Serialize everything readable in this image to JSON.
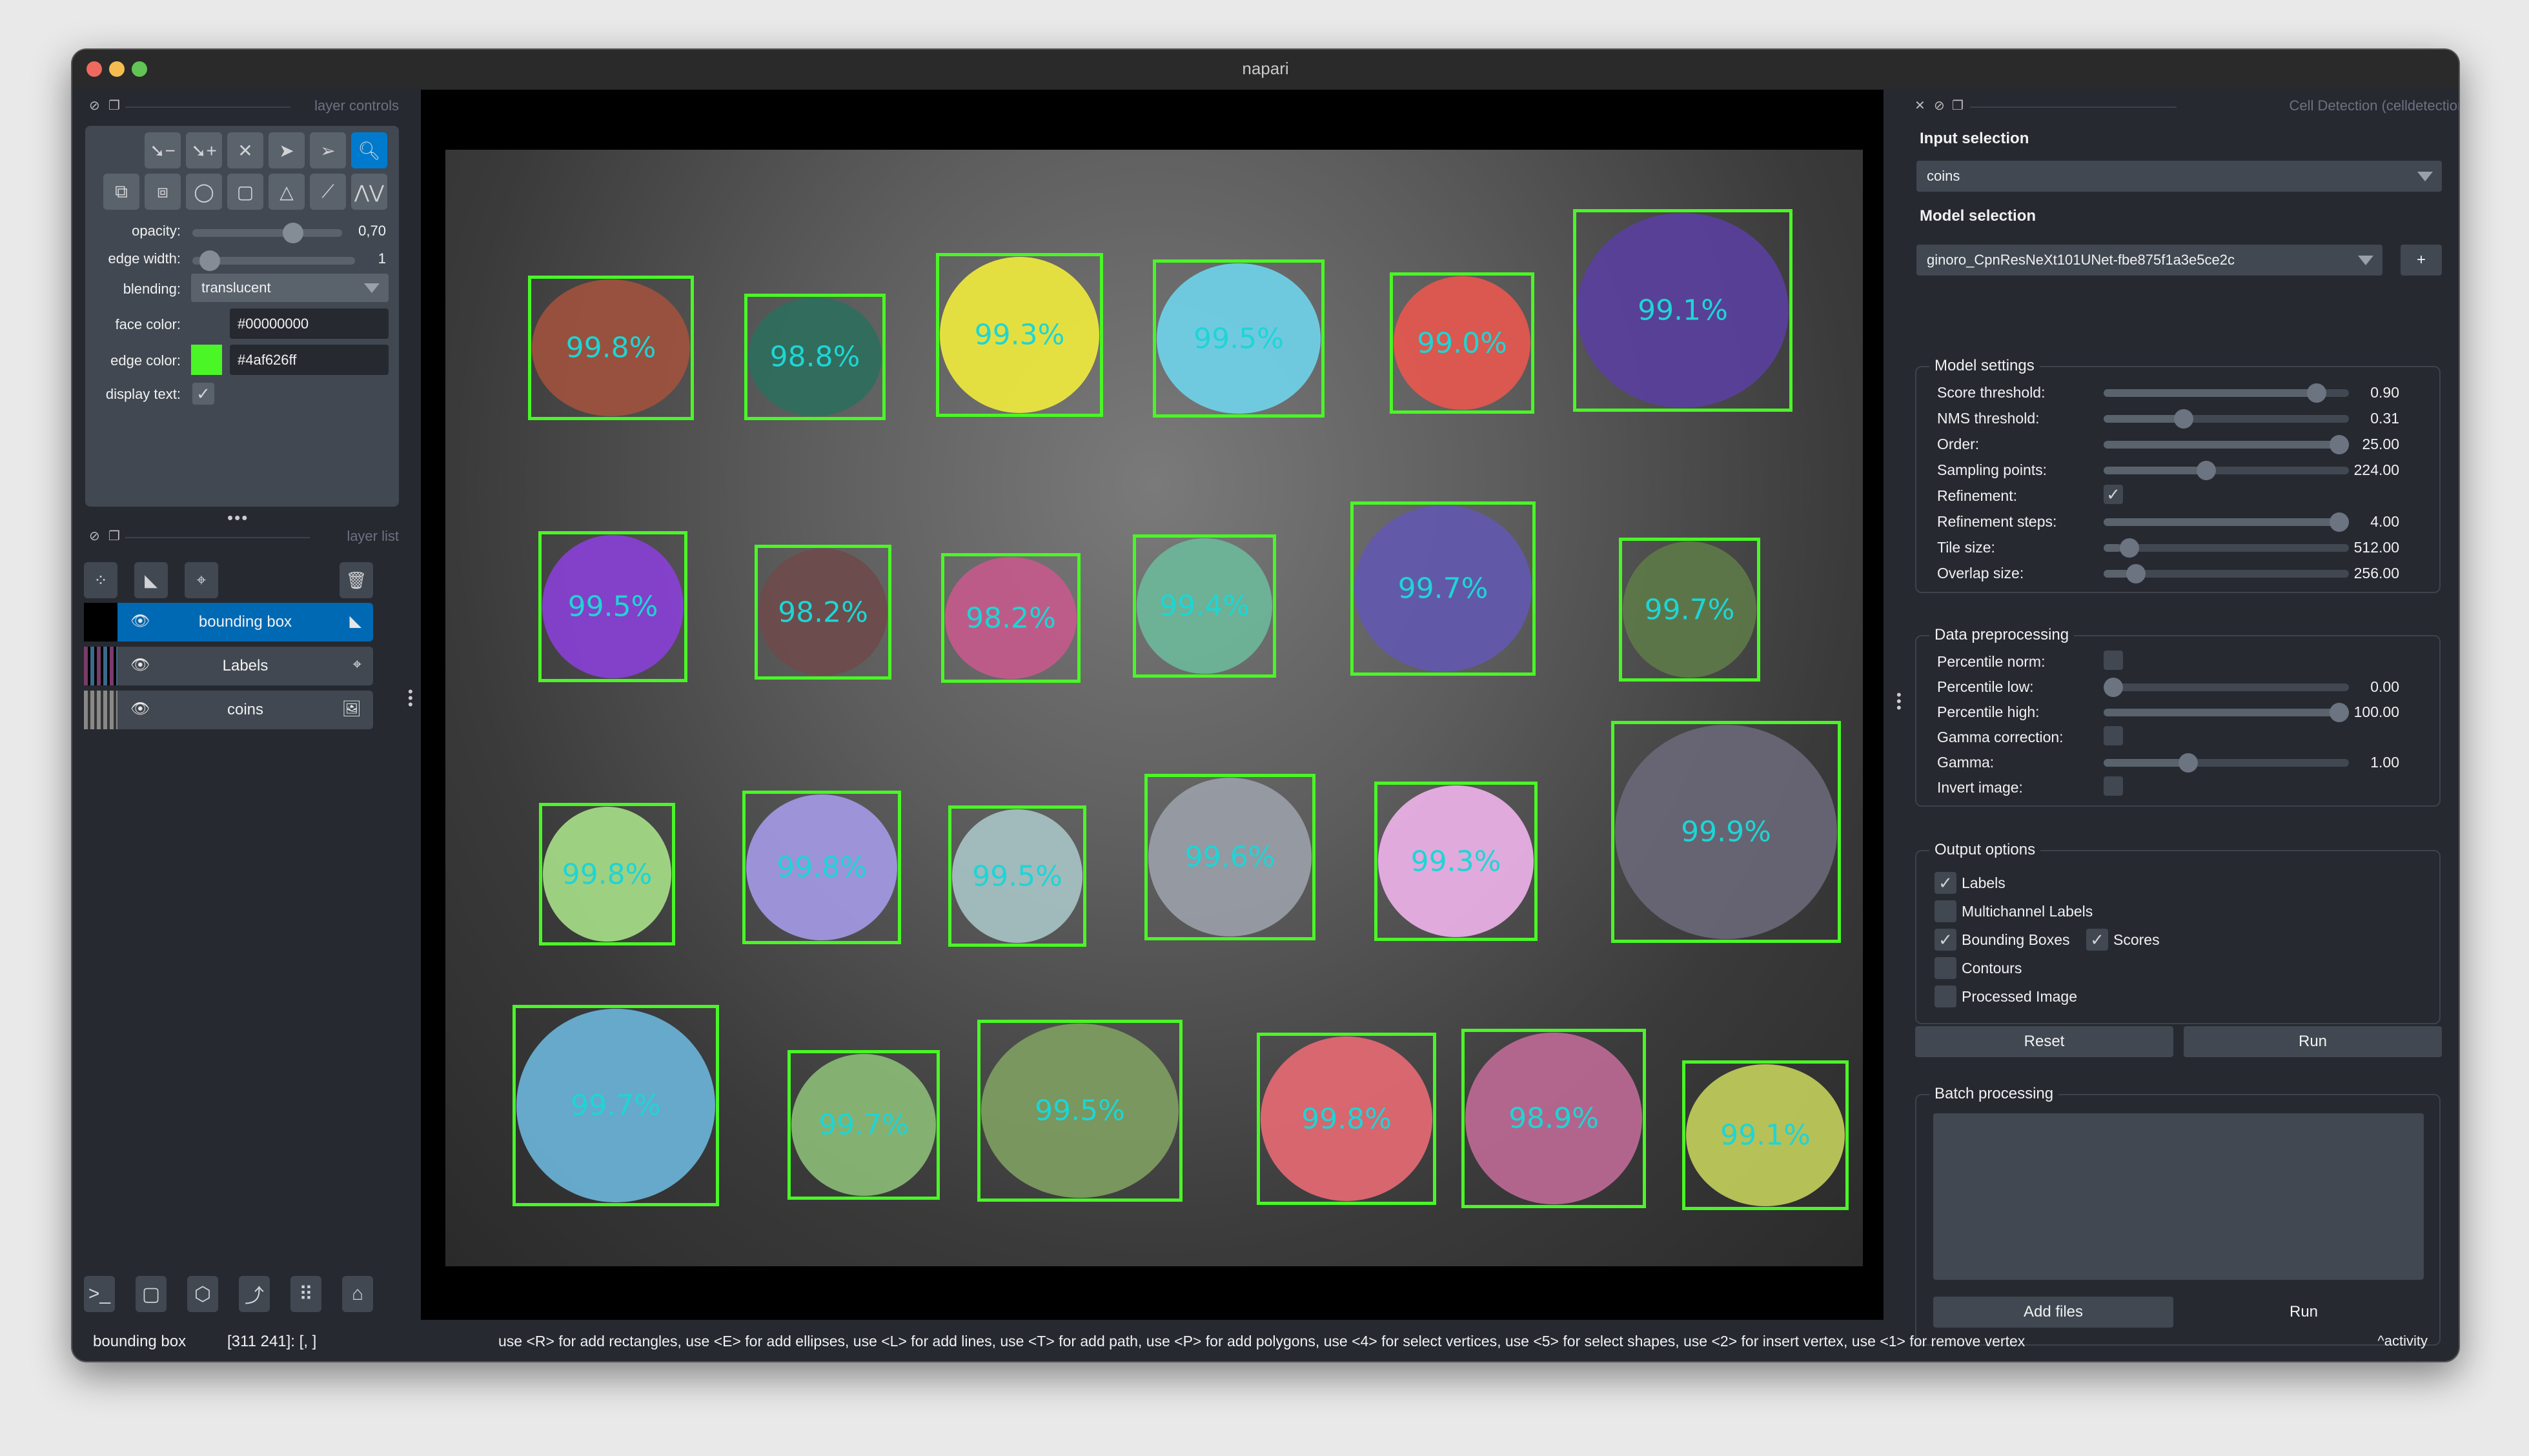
{
  "window": {
    "title": "napari",
    "traffic_lights": {
      "close": "#ee6a5f",
      "minimize": "#f5bd4f",
      "zoom": "#61c454"
    }
  },
  "layer_controls": {
    "header": "layer controls",
    "tools_row1": [
      "remove-points-icon",
      "add-points-icon",
      "delete-icon",
      "select-shapes-icon",
      "select-vertices-icon",
      "pan-zoom-icon"
    ],
    "tools_row2": [
      "move-back-icon",
      "move-front-icon",
      "ellipse-icon",
      "rectangle-icon",
      "polygon-icon",
      "line-icon",
      "path-icon"
    ],
    "opacity": {
      "label": "opacity:",
      "value": "0,70",
      "fraction": 0.7
    },
    "edge_width": {
      "label": "edge width:",
      "value": "1",
      "fraction": 0.05
    },
    "blending": {
      "label": "blending:",
      "value": "translucent"
    },
    "face_color": {
      "label": "face color:",
      "value": "#00000000"
    },
    "edge_color": {
      "label": "edge color:",
      "value": "#4af626ff",
      "swatch": "#4af626"
    },
    "display_text": {
      "label": "display text:",
      "checked": true
    }
  },
  "layer_list": {
    "header": "layer list",
    "layers": [
      {
        "name": "bounding box",
        "type": "shapes",
        "selected": true,
        "visible": true
      },
      {
        "name": "Labels",
        "type": "labels",
        "selected": false,
        "visible": true
      },
      {
        "name": "coins",
        "type": "image",
        "selected": false,
        "visible": true
      }
    ]
  },
  "viewer_buttons": [
    "console-icon",
    "ndisplay-icon",
    "roll-icon",
    "transpose-icon",
    "grid-icon",
    "home-icon"
  ],
  "canvas": {
    "detections": [
      {
        "score": "99.8%",
        "color": "#a0523d"
      },
      {
        "score": "98.8%",
        "color": "#2e6e5c"
      },
      {
        "score": "99.3%",
        "color": "#f2ec3c"
      },
      {
        "score": "99.5%",
        "color": "#6fd4ec"
      },
      {
        "score": "99.0%",
        "color": "#e8584e"
      },
      {
        "score": "99.1%",
        "color": "#5a3f9e"
      },
      {
        "score": "99.5%",
        "color": "#8a3fd6"
      },
      {
        "score": "98.2%",
        "color": "#6e4a4a"
      },
      {
        "score": "98.2%",
        "color": "#c65a8c"
      },
      {
        "score": "99.4%",
        "color": "#6db89a"
      },
      {
        "score": "99.7%",
        "color": "#6258b0"
      },
      {
        "score": "99.7%",
        "color": "#5e7a48"
      },
      {
        "score": "99.8%",
        "color": "#a8e08a"
      },
      {
        "score": "99.8%",
        "color": "#a49ae8"
      },
      {
        "score": "99.5%",
        "color": "#a8c4c6"
      },
      {
        "score": "99.6%",
        "color": "#9aa0aa"
      },
      {
        "score": "99.3%",
        "color": "#f0b4ec"
      },
      {
        "score": "99.9%",
        "color": "#6a6878"
      },
      {
        "score": "99.7%",
        "color": "#6cb6dc"
      },
      {
        "score": "99.7%",
        "color": "#8cbc78"
      },
      {
        "score": "99.5%",
        "color": "#7ea060"
      },
      {
        "score": "99.8%",
        "color": "#e86a74"
      },
      {
        "score": "98.9%",
        "color": "#c06a96"
      },
      {
        "score": "99.1%",
        "color": "#c4d05c"
      }
    ],
    "box_color": "#4af626",
    "text_color": "#1ed5d5"
  },
  "plugin": {
    "header": "Cell Detection (celldetection-napari)",
    "input_selection": {
      "label": "Input selection",
      "value": "coins"
    },
    "model_selection": {
      "label": "Model selection",
      "value": "ginoro_CpnResNeXt101UNet-fbe875f1a3e5ce2c",
      "add_label": "+"
    },
    "model_settings": {
      "title": "Model settings",
      "rows": [
        {
          "label": "Score threshold:",
          "value": "0.90",
          "kind": "slider",
          "fraction": 0.9
        },
        {
          "label": "NMS threshold:",
          "value": "0.31",
          "kind": "slider",
          "fraction": 0.31
        },
        {
          "label": "Order:",
          "value": "25.00",
          "kind": "slider",
          "fraction": 1.0
        },
        {
          "label": "Sampling points:",
          "value": "224.00",
          "kind": "slider",
          "fraction": 0.41
        },
        {
          "label": "Refinement:",
          "value": "",
          "kind": "checkbox",
          "checked": true
        },
        {
          "label": "Refinement steps:",
          "value": "4.00",
          "kind": "slider",
          "fraction": 1.0
        },
        {
          "label": "Tile size:",
          "value": "512.00",
          "kind": "slider",
          "fraction": 0.07
        },
        {
          "label": "Overlap size:",
          "value": "256.00",
          "kind": "slider",
          "fraction": 0.1
        }
      ]
    },
    "data_preprocessing": {
      "title": "Data preprocessing",
      "rows": [
        {
          "label": "Percentile norm:",
          "value": "",
          "kind": "checkbox",
          "checked": false
        },
        {
          "label": "Percentile low:",
          "value": "0.00",
          "kind": "slider",
          "fraction": 0.0
        },
        {
          "label": "Percentile high:",
          "value": "100.00",
          "kind": "slider",
          "fraction": 1.0
        },
        {
          "label": "Gamma correction:",
          "value": "",
          "kind": "checkbox",
          "checked": false
        },
        {
          "label": "Gamma:",
          "value": "1.00",
          "kind": "slider",
          "fraction": 0.33
        },
        {
          "label": "Invert image:",
          "value": "",
          "kind": "checkbox",
          "checked": false
        }
      ]
    },
    "output_options": {
      "title": "Output options",
      "labels": {
        "label": "Labels",
        "checked": true
      },
      "multichannel": {
        "label": "Multichannel Labels",
        "checked": false
      },
      "bounding_boxes": {
        "label": "Bounding Boxes",
        "checked": true
      },
      "scores": {
        "label": "Scores",
        "checked": true
      },
      "contours": {
        "label": "Contours",
        "checked": false
      },
      "processed_image": {
        "label": "Processed Image",
        "checked": false
      }
    },
    "reset_label": "Reset",
    "run_label": "Run",
    "batch": {
      "title": "Batch processing",
      "add_files_label": "Add files",
      "run_label": "Run"
    }
  },
  "statusbar": {
    "layer": "bounding box",
    "coords": "[311 241]: [, ]",
    "help": "use <R> for add rectangles, use <E> for add ellipses, use <L> for add lines, use <T> for add path, use <P> for add polygons, use <4> for select vertices, use <5> for select shapes, use <2> for insert vertex, use <1> for remove vertex",
    "activity": "activity"
  }
}
